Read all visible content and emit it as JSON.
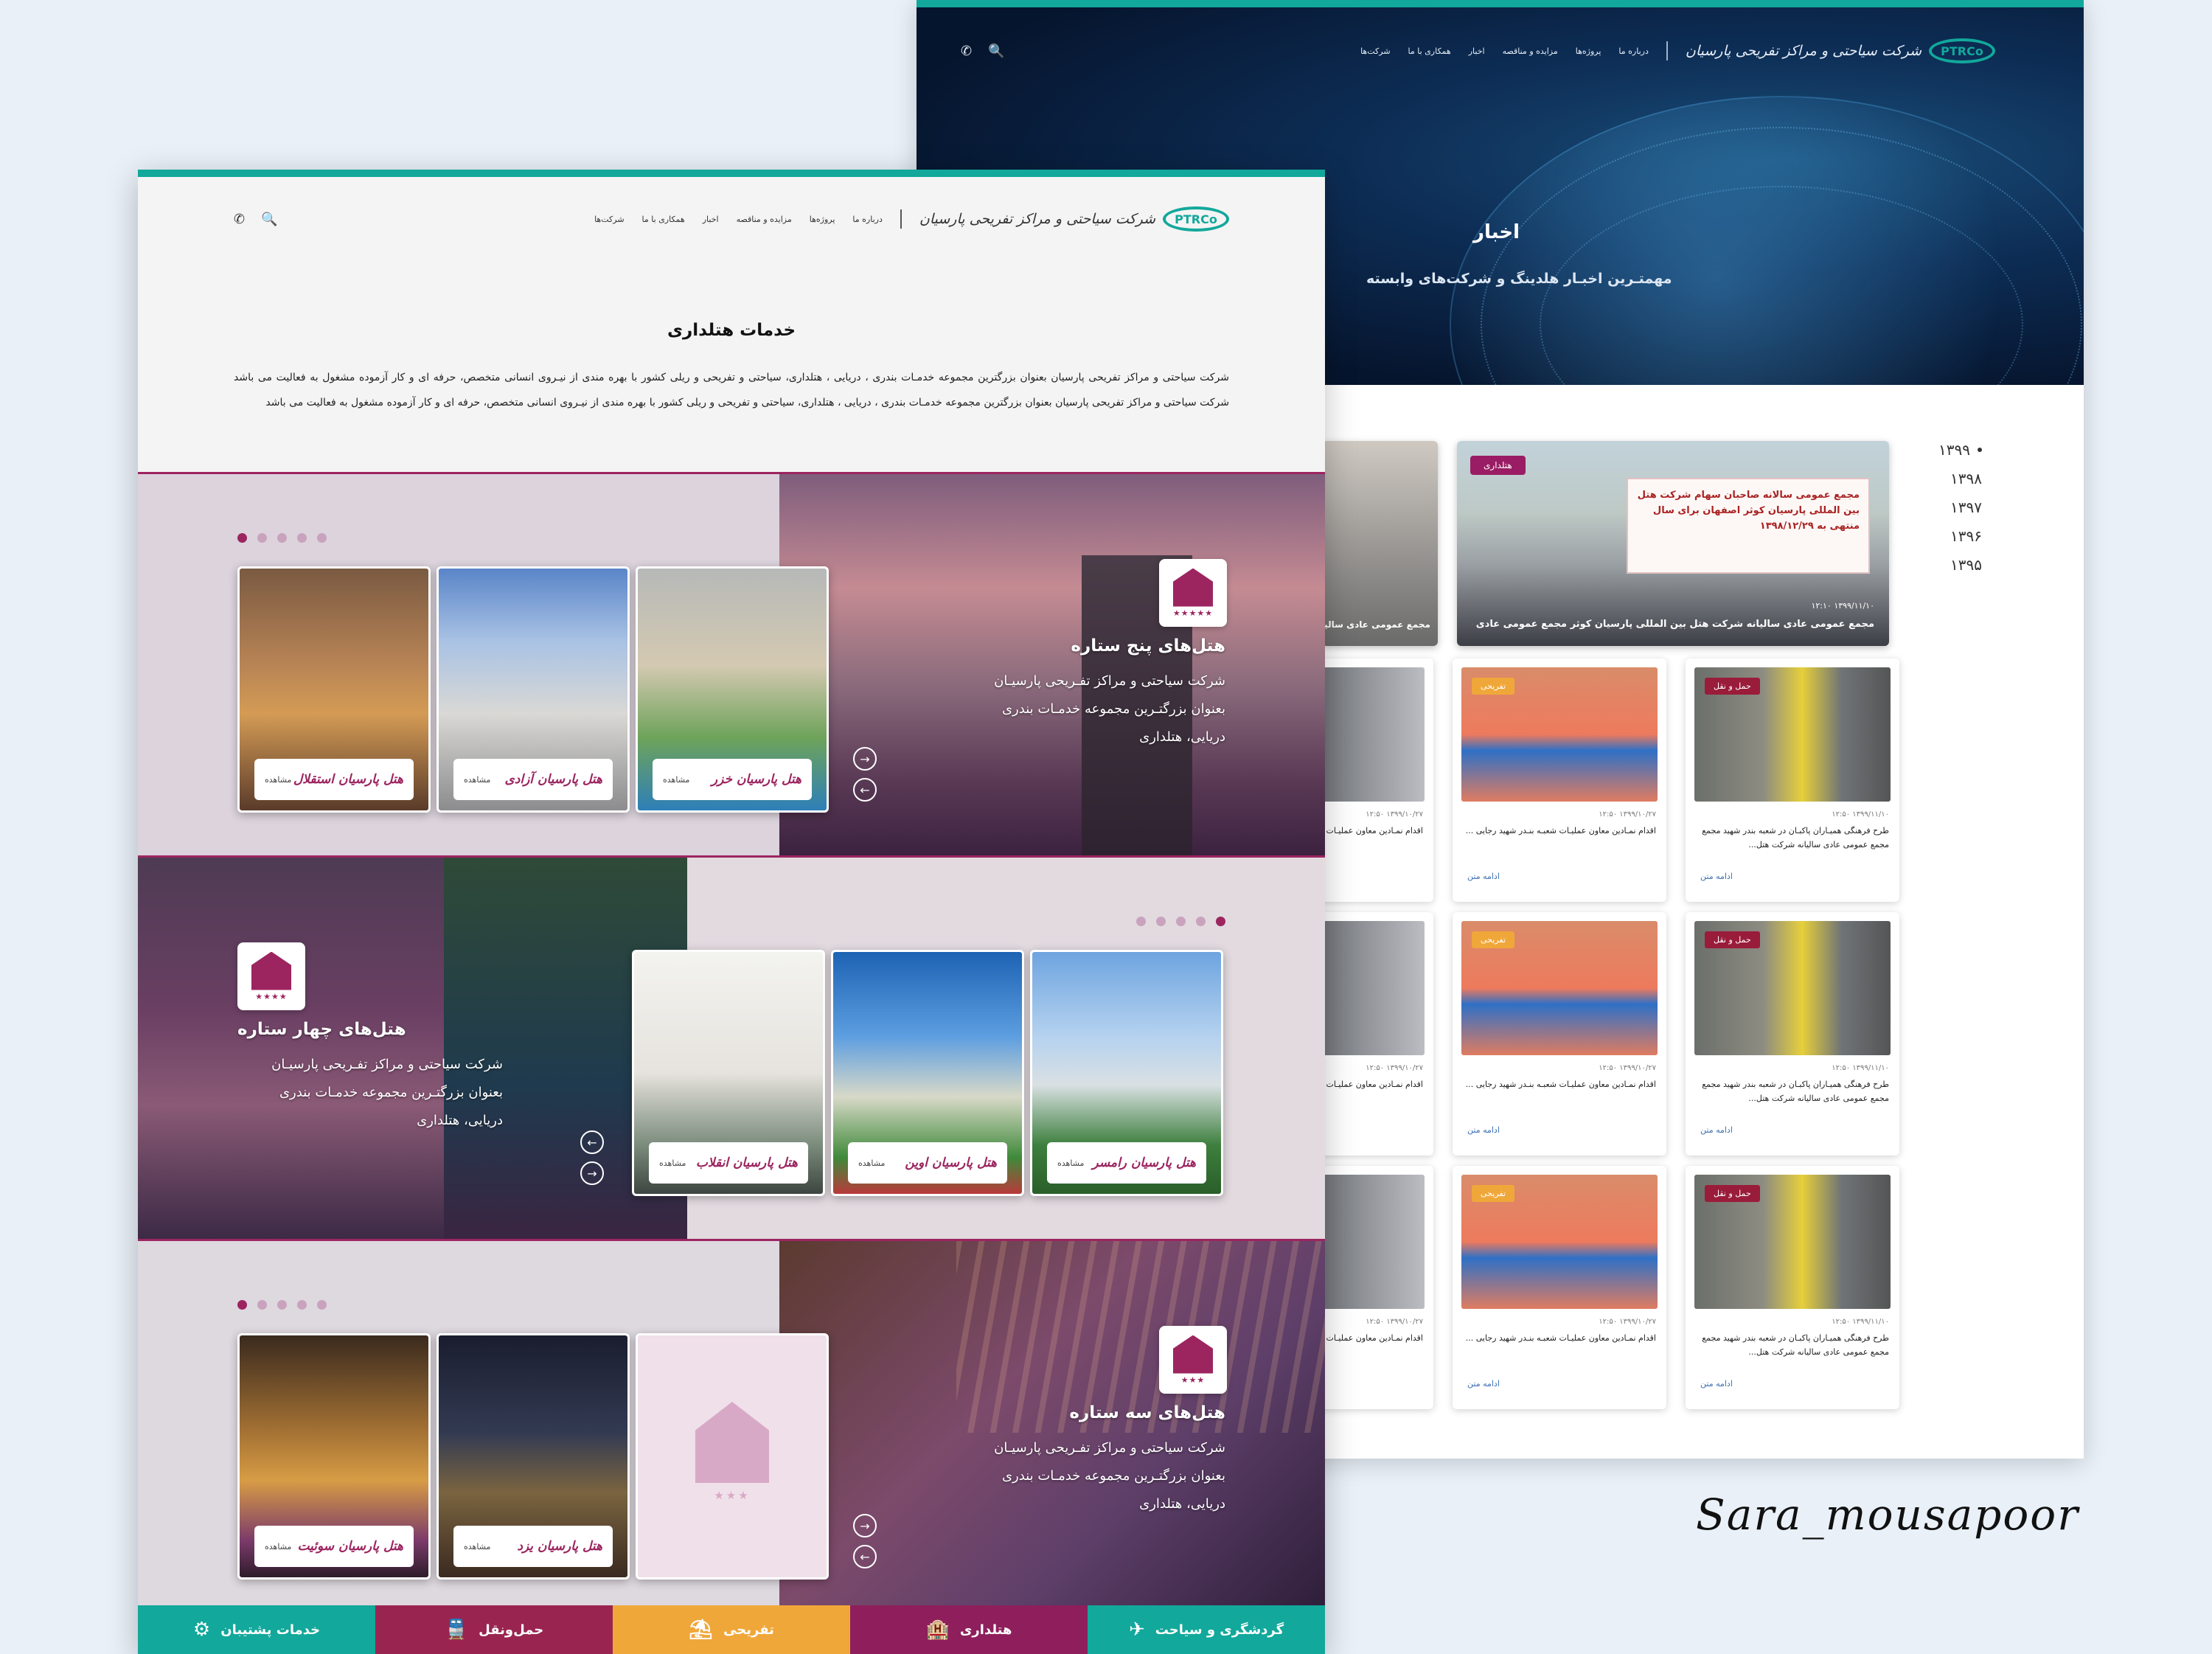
{
  "common": {
    "logo_badge": "PTRCo",
    "company_name": "شرکت سیاحتی و مراکز تفریحی پارسیان",
    "menu": [
      "درباره ما",
      "پروژه‌ها",
      "مزایده و مناقصه",
      "اخبار",
      "همکاری با ما",
      "شرکت‌ها"
    ],
    "search_icon": "🔍",
    "phone_icon": "✆"
  },
  "news_page": {
    "title": "اخبار",
    "subtitle": "مهمتـرین اخبـار هلدینگ و شرکت‌های وابسته",
    "years": [
      "۱۳۹۹",
      "۱۳۹۸",
      "۱۳۹۷",
      "۱۳۹۶",
      "۱۳۹۵"
    ],
    "feature": {
      "tag": "هتلداری",
      "banner": "مجمع عمومی سالانه صاحبان سهام شرکت هتل بین المللی پارسیان کوثر اصفهان برای سال منتهی به ۱۳۹۸/۱۲/۲۹",
      "meta": "۱۳۹۹/۱۱/۱۰  ۱۲:۱۰",
      "caption": "مجمع عمومی عادی سالیانه شرکت هتل بین المللی پارسیان کوثر مجمع عمومی عادی سالیانه شرکت هتل..."
    },
    "feature_side_caption": "مجمع عمومی عادی سالیانه",
    "cards": [
      {
        "tag": "حمل و نقل",
        "meta": "۱۳۹۹/۱۱/۱۰  ۱۲:۵۰",
        "title": "طرح فرهنگی همیـاران پاکبـان در شعبه بندر شهید مجمع مجمع عمومی عادی سالیانه شرکت هتل...",
        "more": "ادامه متن"
      },
      {
        "tag": "تفریحی",
        "meta": "۱۳۹۹/۱۰/۲۷  ۱۲:۵۰",
        "title": "اقدام نمـادین معاون عملیـات شعبـه بنـدر شهید رجایی ...",
        "more": "ادامه متن"
      },
      {
        "tag": "",
        "meta": "۱۳۹۹/۱۰/۲۷  ۱۲:۵۰",
        "title": "اقدام نمـادین معاون عملیـات شعبـه بنـدر شهید رجایی ...",
        "more": "ادامه متن"
      }
    ]
  },
  "hotel_page": {
    "title": "خدمات هتلداری",
    "intro": "شرکت سیاحتی و مراکز تفریحی پارسیان بعنوان بزرگترین مجموعه خدمـات بندری ، دریایی ، هتلداری، سیاحتی و تفریحی و ریلی کشور با بهره مندی از نیـروی انسانی متخصص، حرفه ای و کار آزموده مشغول به فعالیت می باشد شرکت سیاحتی و مراکز تفریحی پارسیان بعنوان بزرگترین مجموعه خدمـات بندری ، دریایی ، هتلداری، سیاحتی و تفریحی و ریلی کشور با بهره مندی از نیـروی انسانی متخصص، حرفه ای و کار آزموده مشغول به فعالیت می باشد",
    "view_label": "مشاهده",
    "sections": [
      {
        "title": "هتل‌های پنج ستاره",
        "stars": "★★★★★",
        "desc": "شرکت سیاحتی و مراکز تفـریحی پارسیـان بعنوان بزرگتـرین مجموعه خدمـات بندری دریایی، هتلداری",
        "hotels": [
          "هتل پارسیان خزر",
          "هتل پارسیان آزادی",
          "هتل پارسیان استقلال"
        ]
      },
      {
        "title": "هتل‌های چهار ستاره",
        "stars": "★★★★",
        "desc": "شرکت سیاحتی و مراکز تفـریحی پارسیـان بعنوان بزرگتـرین مجموعه خدمـات بندری دریایی، هتلداری",
        "hotels": [
          "هتل پارسیان رامسر",
          "هتل پارسیان اوین",
          "هتل پارسیان انقلاب"
        ]
      },
      {
        "title": "هتل‌های سه ستاره",
        "stars": "★★★",
        "desc": "شرکت سیاحتی و مراکز تفـریحی پارسیـان بعنوان بزرگتـرین مجموعه خدمـات بندری دریایی، هتلداری",
        "hotels": [
          "",
          "هتل پارسیان یزد",
          "هتل پارسیان سوئیت"
        ],
        "empty_stars": "★★★"
      }
    ],
    "tabs": [
      {
        "label": "گردشگری و سیاحت",
        "icon": "✈",
        "color": "#12a89b"
      },
      {
        "label": "هتلداری",
        "icon": "🏨",
        "color": "#8e1f5c"
      },
      {
        "label": "تفریحی",
        "icon": "⛱",
        "color": "#f0a73a"
      },
      {
        "label": "حمل‌ونقل",
        "icon": "🚆",
        "color": "#9a2450"
      },
      {
        "label": "خدمات پشتیبان",
        "icon": "⚙",
        "color": "#12a89b"
      }
    ]
  },
  "signature": "Sara_mousapoor",
  "colors": {
    "teal": "#12a89b",
    "plum": "#9c2560",
    "orange": "#f0a73a",
    "navy": "#0d2d55"
  }
}
